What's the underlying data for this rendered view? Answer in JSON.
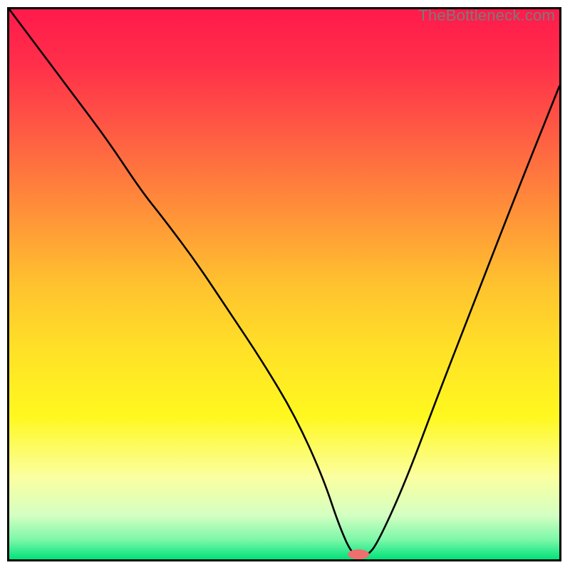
{
  "watermark": "TheBottleneck.com",
  "chart_data": {
    "type": "line",
    "title": "",
    "xlabel": "",
    "ylabel": "",
    "xlim": [
      0,
      100
    ],
    "ylim": [
      0,
      100
    ],
    "grid": false,
    "legend": false,
    "gradient_stops": [
      {
        "offset": 0.0,
        "color": "#ff1a4b"
      },
      {
        "offset": 0.1,
        "color": "#ff2f4a"
      },
      {
        "offset": 0.22,
        "color": "#ff5a44"
      },
      {
        "offset": 0.35,
        "color": "#ff8a3a"
      },
      {
        "offset": 0.5,
        "color": "#ffc22f"
      },
      {
        "offset": 0.62,
        "color": "#ffe127"
      },
      {
        "offset": 0.74,
        "color": "#fff81f"
      },
      {
        "offset": 0.85,
        "color": "#fbffa0"
      },
      {
        "offset": 0.92,
        "color": "#d4ffc2"
      },
      {
        "offset": 0.965,
        "color": "#7bf7a8"
      },
      {
        "offset": 1.0,
        "color": "#00e27a"
      }
    ],
    "series": [
      {
        "name": "bottleneck-curve",
        "x": [
          0,
          6,
          12,
          18,
          24,
          28,
          34,
          40,
          46,
          52,
          57,
          60,
          62.5,
          65,
          67,
          72,
          78,
          85,
          92,
          100
        ],
        "y": [
          100,
          92,
          84,
          76,
          67,
          62,
          54,
          45,
          36,
          26,
          15,
          6,
          0.5,
          0.5,
          3,
          14,
          30,
          48,
          66,
          86
        ]
      }
    ],
    "marker": {
      "name": "optimal-point",
      "x": 63.5,
      "y": 0.9,
      "color": "#ef6e6e",
      "rx": 15,
      "ry": 7
    }
  }
}
